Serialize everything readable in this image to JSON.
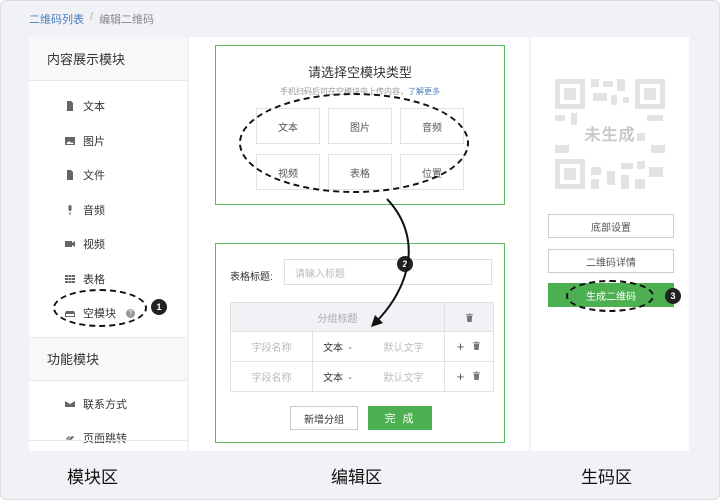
{
  "breadcrumb": {
    "parent": "二维码列表",
    "separator": "/",
    "current": "编辑二维码"
  },
  "left": {
    "section1_title": "内容展示模块",
    "items": [
      {
        "label": "文本",
        "icon": "document-icon"
      },
      {
        "label": "图片",
        "icon": "image-icon"
      },
      {
        "label": "文件",
        "icon": "file-icon"
      },
      {
        "label": "音频",
        "icon": "microphone-icon"
      },
      {
        "label": "视频",
        "icon": "video-camera-icon"
      },
      {
        "label": "表格",
        "icon": "table-icon"
      },
      {
        "label": "空模块",
        "icon": "empty-block-icon",
        "help": "?"
      }
    ],
    "section2_title": "功能模块",
    "items2": [
      {
        "label": "联系方式",
        "icon": "envelope-icon"
      },
      {
        "label": "页面跳转",
        "icon": "link-icon"
      }
    ]
  },
  "editor": {
    "select_title": "请选择空模块类型",
    "select_subtitle": "手机扫码后可在空模块中上传内容，",
    "learn_more": "了解更多",
    "types": [
      "文本",
      "图片",
      "音频",
      "视频",
      "表格",
      "位置"
    ],
    "table_title_label": "表格标题:",
    "table_title_placeholder": "请输入标题",
    "group_header": "分组标题",
    "rows": [
      {
        "name_placeholder": "字段名称",
        "type": "文本",
        "default_placeholder": "默认文字"
      },
      {
        "name_placeholder": "字段名称",
        "type": "文本",
        "default_placeholder": "默认文字"
      }
    ],
    "add_group": "新增分组",
    "done": "完 成"
  },
  "right": {
    "qr_status": "未生成",
    "buttons": {
      "footer": "底部设置",
      "detail": "二维码详情",
      "generate": "生成二维码"
    }
  },
  "annotations": {
    "one": "1",
    "two": "2",
    "three": "3"
  },
  "zones": {
    "module": "模块区",
    "edit": "编辑区",
    "generate": "生码区"
  },
  "colors": {
    "accent_green": "#4caf50",
    "link_blue": "#4a7fc1",
    "panel_bg": "#f0f2f5"
  }
}
